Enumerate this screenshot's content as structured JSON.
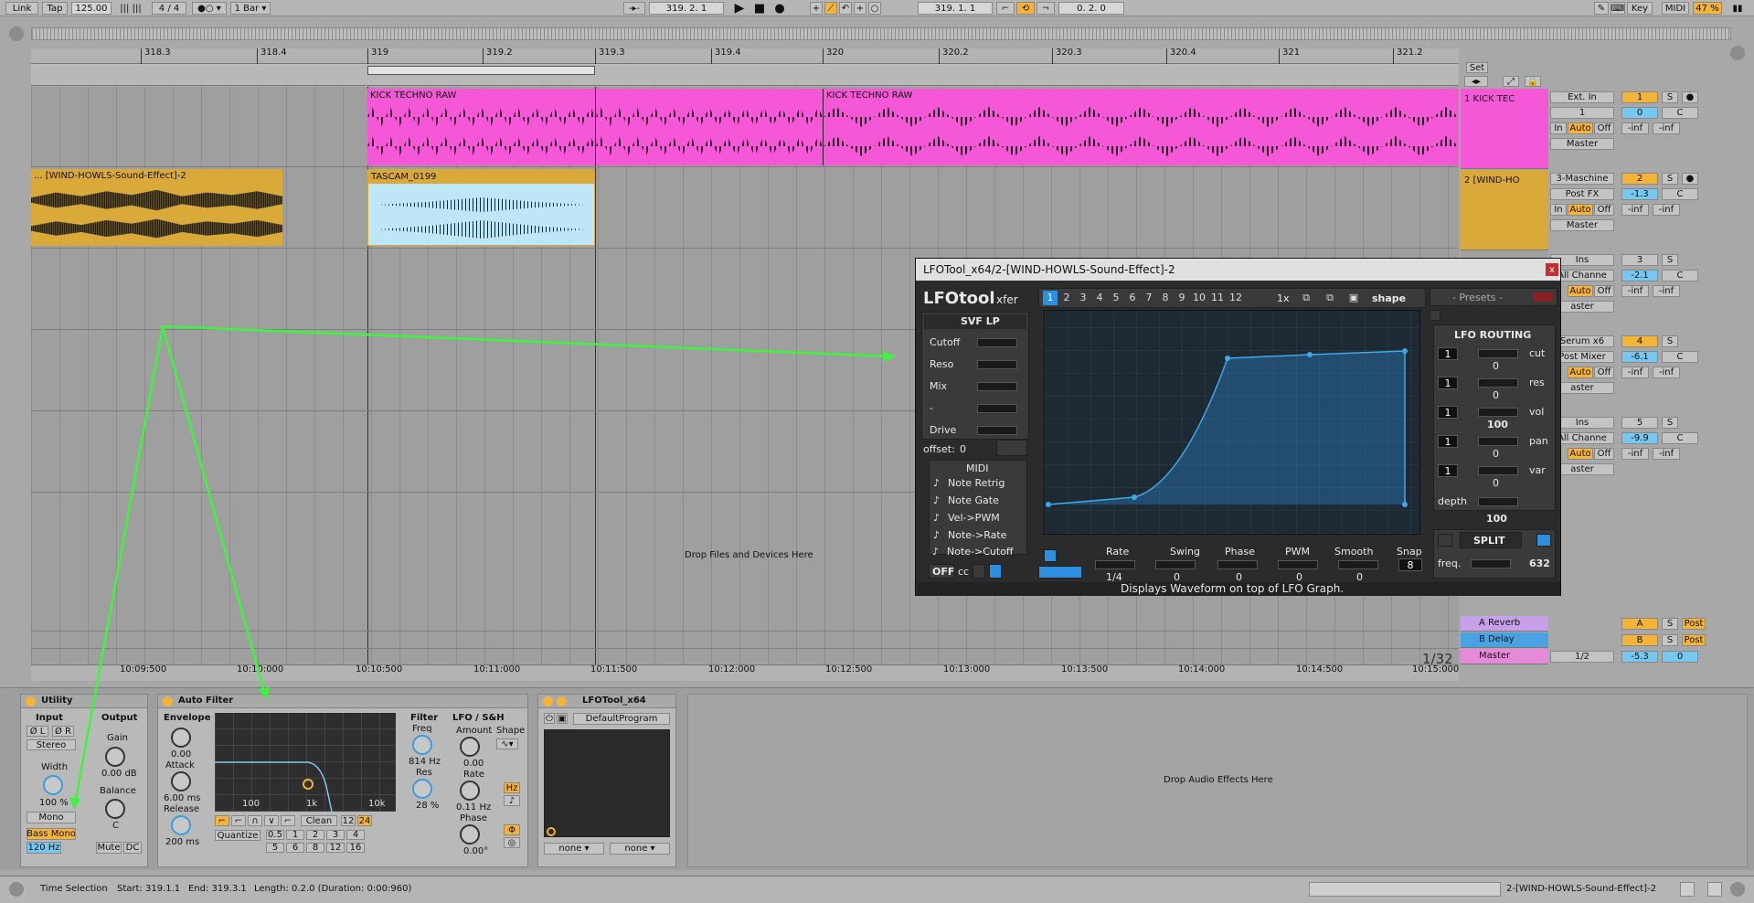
{
  "topbar": {
    "link": "Link",
    "tap": "Tap",
    "tempo": "125.00",
    "sig_num": "4",
    "sig_sep": "/",
    "sig_den": "4",
    "quant": "1 Bar",
    "pos_bar": "319",
    "pos_beat": "2",
    "pos_six": "1",
    "loop_bar": "319",
    "loop_beat": "1",
    "loop_six": "1",
    "len_bar": "0",
    "len_beat": "2",
    "len_six": "0",
    "key": "Key",
    "midi": "MIDI",
    "cpu": "47 %"
  },
  "ruler": {
    "ticks": [
      "318.3",
      "318.4",
      "319",
      "319.2",
      "319.3",
      "319.4",
      "320",
      "320.2",
      "320.3",
      "320.4",
      "321",
      "321.2"
    ],
    "set_label": "Set"
  },
  "clips": {
    "kick1": "KICK TECHNO RAW",
    "kick2": "KICK TECHNO RAW",
    "wind": "... [WIND-HOWLS-Sound-Effect]-2",
    "tascam": "TASCAM_0199"
  },
  "drop_files": "Drop Files and Devices Here",
  "drop_effects": "Drop Audio Effects Here",
  "zoom_label": "1/32",
  "tracks": [
    {
      "name": "1 KICK TEC",
      "input": "Ext. In",
      "channel": "1",
      "monitor": [
        "In",
        "Auto",
        "Off"
      ],
      "output": "Master",
      "num": "1",
      "vol": "0",
      "s": "S",
      "pan": "C",
      "inf1": "-inf",
      "inf2": "-inf",
      "color": "#f558d6"
    },
    {
      "name": "2 [WIND-HO",
      "input": "3-Maschine",
      "channel": "Post FX",
      "monitor": [
        "In",
        "Auto",
        "Off"
      ],
      "output": "Master",
      "num": "2",
      "vol": "-1.3",
      "s": "S",
      "pan": "C",
      "inf1": "-inf",
      "inf2": "-inf",
      "color": "#d9a93a"
    },
    {
      "name": "",
      "input": "Ins",
      "channel": "All Channe",
      "monitor": [
        "Auto",
        "Off"
      ],
      "output": "aster",
      "num": "3",
      "vol": "-2.1",
      "s": "S",
      "pan": "C",
      "inf1": "-inf",
      "inf2": "-inf",
      "color": ""
    },
    {
      "name": "",
      "input": "Serum x6",
      "channel": "Post Mixer",
      "monitor": [
        "Auto",
        "Off"
      ],
      "output": "aster",
      "num": "4",
      "vol": "-6.1",
      "s": "S",
      "pan": "C",
      "inf1": "-inf",
      "inf2": "-inf",
      "color": ""
    },
    {
      "name": "",
      "input": "Ins",
      "channel": "All Channe",
      "monitor": [
        "Auto",
        "Off"
      ],
      "output": "aster",
      "num": "5",
      "vol": "-9.9",
      "s": "S",
      "pan": "C",
      "inf1": "-inf",
      "inf2": "-inf",
      "color": ""
    }
  ],
  "returns": [
    {
      "name": "A Reverb",
      "letter": "A",
      "s": "S",
      "post": "Post",
      "color": "#c6a0e8"
    },
    {
      "name": "B Delay",
      "letter": "B",
      "s": "S",
      "post": "Post",
      "color": "#4aa3e0"
    },
    {
      "name": "Master",
      "letter": "",
      "s": "",
      "post": "",
      "color": "#e58ad8",
      "routing": "1/2",
      "vol": "-5.3",
      "pan": "0"
    }
  ],
  "timeline": [
    "10:09:500",
    "10:10:000",
    "10:10:500",
    "10:11:000",
    "10:11:500",
    "10:12:000",
    "10:12:500",
    "10:13:000",
    "10:13:500",
    "10:14:000",
    "10:14:500",
    "10:15:000"
  ],
  "utility": {
    "title": "Utility",
    "input": "Input",
    "output": "Output",
    "phase_l": "Ø L",
    "phase_r": "Ø R",
    "mode": "Stereo",
    "gain_label": "Gain",
    "gain": "0.00 dB",
    "width_label": "Width",
    "width": "100 %",
    "balance_label": "Balance",
    "balance": "C",
    "mono": "Mono",
    "bassmono": "Bass Mono",
    "bassfreq": "120 Hz",
    "mute": "Mute",
    "dc": "DC"
  },
  "autofilter": {
    "title": "Auto Filter",
    "envelope": "Envelope",
    "env_val": "0.00",
    "attack": "Attack",
    "attack_val": "6.00 ms",
    "release": "Release",
    "release_val": "200 ms",
    "filter": "Filter",
    "freq": "Freq",
    "freq_val": "814 Hz",
    "res": "Res",
    "res_val": "28 %",
    "lfo": "LFO / S&H",
    "amount": "Amount",
    "amount_val": "0.00",
    "rate": "Rate",
    "rate_val": "0.11 Hz",
    "phase": "Phase",
    "phase_val": "0.00°",
    "shape": "Shape",
    "hz": "Hz",
    "quantize": "Quantize",
    "clean": "Clean",
    "n12": "12",
    "n24": "24",
    "graph_labels": [
      "100",
      "1k",
      "10k"
    ],
    "quant_vals": [
      "0.5",
      "1",
      "2",
      "3",
      "4",
      "5",
      "6",
      "8",
      "12",
      "16"
    ]
  },
  "lfodev": {
    "title": "LFOTool_x64",
    "program": "DefaultProgram",
    "sel1": "none",
    "sel2": "none"
  },
  "plugin": {
    "title": "LFOTool_x64/2-[WIND-HOWLS-Sound-Effect]-2",
    "close": "x",
    "logo": "LFOtool",
    "brand": "xfer",
    "graph_nums": [
      "1",
      "2",
      "3",
      "4",
      "5",
      "6",
      "7",
      "8",
      "9",
      "10",
      "11",
      "12"
    ],
    "mult": "1x",
    "shape": "shape",
    "presets": "- Presets -",
    "filter_type": "SVF LP",
    "params": [
      "Cutoff",
      "Reso",
      "Mix",
      "-",
      "Drive"
    ],
    "offset_label": "offset:",
    "offset": "0",
    "midi_title": "MIDI",
    "midi_opts": [
      "Note Retrig",
      "Note Gate",
      "Vel->PWM",
      "Note->Rate",
      "Note->Cutoff"
    ],
    "off": "OFF",
    "cc": "cc",
    "routing_title": "LFO ROUTING",
    "routes": [
      {
        "num": "1",
        "name": "cut",
        "val": "0"
      },
      {
        "num": "1",
        "name": "res",
        "val": "0"
      },
      {
        "num": "1",
        "name": "vol",
        "val": "100"
      },
      {
        "num": "1",
        "name": "pan",
        "val": "0"
      },
      {
        "num": "1",
        "name": "var",
        "val": "0"
      }
    ],
    "depth_label": "depth",
    "depth": "100",
    "split": "SPLIT",
    "freq_label": "freq.",
    "freq": "632",
    "bottom_labels": [
      "Rate",
      "Swing",
      "Phase",
      "PWM",
      "Smooth",
      "Snap"
    ],
    "bottom_vals": [
      "1/4",
      "0",
      "0",
      "0",
      "0",
      "8"
    ],
    "hint": "Displays Waveform on top of LFO Graph."
  },
  "status": {
    "label": "Time Selection",
    "start": "Start: 319.1.1",
    "end": "End: 319.3.1",
    "length": "Length: 0.2.0  (Duration: 0:00:960)",
    "track": "2-[WIND-HOWLS-Sound-Effect]-2"
  },
  "colors": {
    "kick": "#f558d6",
    "wind": "#d9a93a",
    "selection": "#bfe6f7",
    "accent": "#f4b437",
    "arrow": "#3ef53e",
    "lfo_blue": "#2e8fe0"
  }
}
